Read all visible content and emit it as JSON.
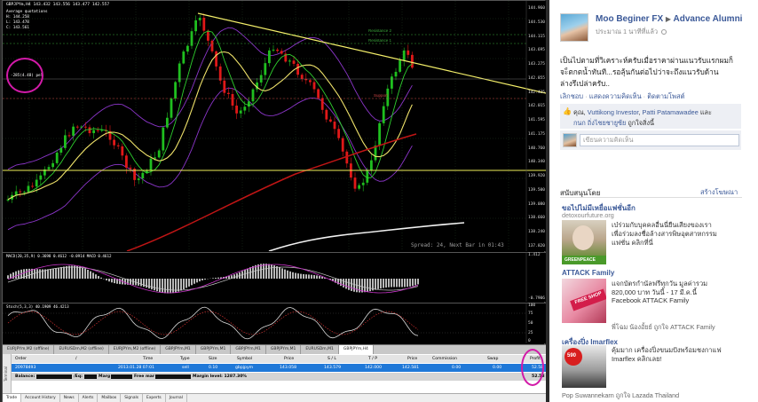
{
  "chart": {
    "title": "GBPJPYm,H4",
    "ohlc": "143.432 143.556 143.477 142.557",
    "info_lines": [
      "Average quotations",
      "H: 144.258",
      "L: 143.478",
      "C: 143.561"
    ],
    "circled_label": "-285(4.48) pel",
    "resistance_labels": [
      "Resistance 2",
      "Resistance 1"
    ],
    "support_label": "Support",
    "spread_text": "Spread: 24, Next Bar in 01:43",
    "price_labels": [
      "144.960",
      "144.530",
      "144.115",
      "143.695",
      "143.275",
      "142.855",
      "142.435",
      "142.015",
      "141.595",
      "141.175",
      "140.760",
      "140.340",
      "139.920",
      "139.500",
      "139.080",
      "138.660",
      "138.240",
      "137.820"
    ],
    "macd_label": "MACD(20,35,9) 0.3698 0.4612 -0.0914 MACD 0.4612",
    "macd_scale": [
      "1.412",
      "-0.7906"
    ],
    "stoch_label": "Stoch(5,3,3) 40.1909 46.4213",
    "stoch_scale": [
      "100",
      "75",
      "50",
      "25",
      "0"
    ]
  },
  "symbol_tabs": [
    "EURJPYm,M2 (offline)",
    "EURUSDm,M2 (offline)",
    "EURJPYm,M2 (offline)",
    "GBPJPYm,M1",
    "GBPJPYm,M1",
    "GBPJPYm,M1",
    "GBPJPYm,M1",
    "EURUSDm,M1",
    "GBPJPYm,H4"
  ],
  "terminal": {
    "side_label": "Terminal",
    "headers": [
      "Order",
      "/",
      "Time",
      "Type",
      "Size",
      "Symbol",
      "Price",
      "S / L",
      "T / P",
      "Price",
      "Commission",
      "Swap",
      "Profit"
    ],
    "order_row": [
      "20978493",
      "2013.01.28 07:01",
      "sell",
      "0.10",
      "gbpjpym",
      "143.058",
      "143.579",
      "142.000",
      "142.581",
      "0.00",
      "0.00",
      "52.58"
    ],
    "balance_prefix": "Balance:",
    "balance_mid1": "/Eq:",
    "balance_mid2": "Marg",
    "balance_mid3": "Free mar",
    "margin_level": "Margin level: 1287.30%",
    "balance_profit": "52.58",
    "bottom_tabs": [
      "Trade",
      "Account History",
      "News",
      "Alerts",
      "Mailbox",
      "Signals",
      "Experts",
      "Journal"
    ]
  },
  "facebook": {
    "poster_name": "Moo Beginer FX",
    "group_name": "Advance Alumni",
    "timestamp": "ประมาณ 1 นาทีที่แล้ว",
    "post_text_1": "เป็นไปตามที่วิเคราะห์ครับเมื่อราคาผ่านแนวรับแรกผมก็",
    "post_text_2": "จะ็ตกตน้ำทันที...รอลุ้นกันต่อไปว่าจะถึงแนวรับด้าน",
    "post_text_3": "ล่างรึเปล่าครับ..",
    "action_unlike": "เลิกชอบ",
    "action_comment": "แสดงความคิดเห็น",
    "action_unfollow": "ติดตามโพสต์",
    "likes_prefix": "คุณ,",
    "liker_1": "Vuttikong Investor",
    "liker_2": "Patti Patamawadee",
    "likes_and": "และ",
    "liker_3": "กนก ถิ่งไชยชายูซ้ย",
    "likes_suffix": "ถูกใจสิ่งนี้",
    "comment_placeholder": "เขียนความคิดเห็น",
    "sponsored": "สนับสนุนโดย",
    "create_ad": "สร้างโฆษณา",
    "ad1_title": "ขอไปไม่มีเหยื่อแฟชั่นอีก",
    "ad1_domain": "detoxourfuture.org",
    "ad1_body": [
      "เบ๋ร่วมกับบุคคลอื่นนี่ยืนเสียงของเรา",
      "เพื่อร่วมลงชื่อล้างสารพิษอุตสาหกรรม",
      "แฟชั่น คลิกที่นี่"
    ],
    "ad1_badge": "GREENPEACE",
    "ad2_title": "ATTACK Family",
    "ad2_body": [
      "แจกบัตรกำนัลฟรีทุกวัน มูลค่ารวม",
      "820,000 บาท วันนี้ - 17 มี.ค.นี้",
      "Facebook ATTACK Family"
    ],
    "ad2_badge": "FREE SHOP",
    "ad2_social": "พี่โฉม น้องอั้ยย์ ถูกใจ ATTACK Family",
    "ad3_title": "เครื่องปิ่ง Imarflex",
    "ad3_body": [
      "คุ้มมาก เครื่องปิ่งขนมปังพร้อมชงกาแฟ",
      "Imarflex คลิกเลย!"
    ],
    "ad3_price": "590",
    "ad3_social": "Pop Suwannekarn ถูกใจ Lazada Thailand"
  }
}
